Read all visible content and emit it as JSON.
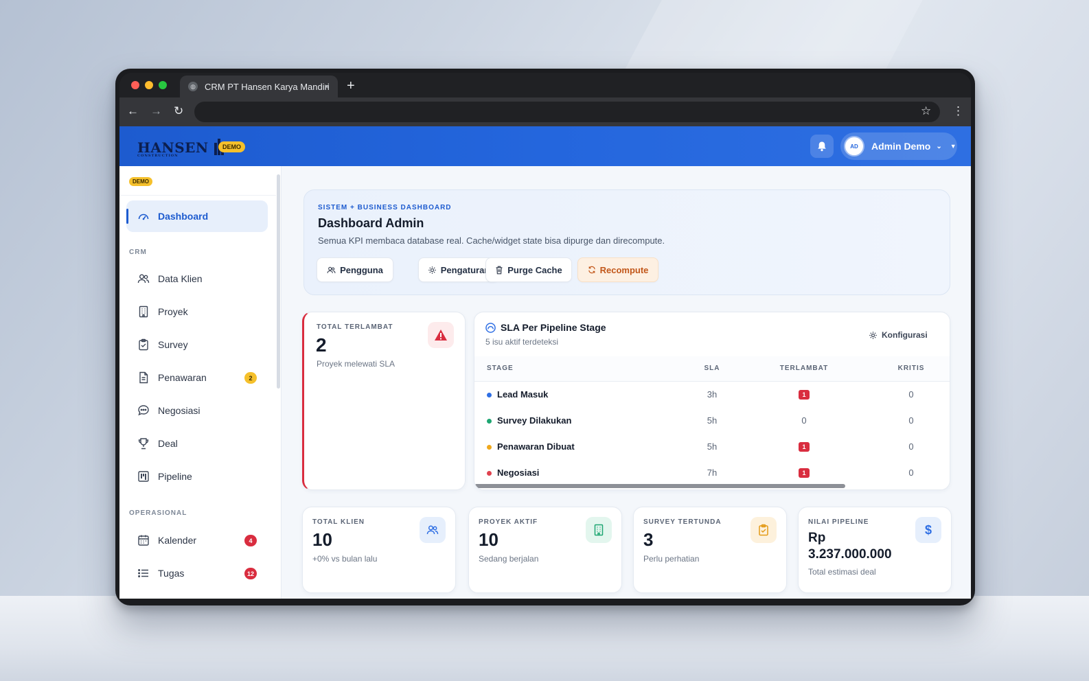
{
  "browser": {
    "tab_title": "CRM PT Hansen Karya Mandiri",
    "new_tab": "+",
    "tab_close": "×"
  },
  "app": {
    "logo_text": "HANSEN",
    "logo_sub": "CONSTRUCTION",
    "demo_badge": "DEMO",
    "user_initials": "AD",
    "user_name": "Admin Demo"
  },
  "sidebar": {
    "demo_badge": "DEMO",
    "dashboard": "Dashboard",
    "section_crm": "CRM",
    "items_crm": [
      {
        "label": "Data Klien",
        "icon": "users-icon"
      },
      {
        "label": "Proyek",
        "icon": "building-icon"
      },
      {
        "label": "Survey",
        "icon": "clipboard-icon"
      },
      {
        "label": "Penawaran",
        "icon": "document-icon",
        "badge": "2"
      },
      {
        "label": "Negosiasi",
        "icon": "chat-icon"
      },
      {
        "label": "Deal",
        "icon": "trophy-icon"
      },
      {
        "label": "Pipeline",
        "icon": "kanban-icon"
      }
    ],
    "section_ops": "OPERASIONAL",
    "items_ops": [
      {
        "label": "Kalender",
        "icon": "calendar-icon",
        "badge": "4"
      },
      {
        "label": "Tugas",
        "icon": "list-icon",
        "badge": "12"
      }
    ]
  },
  "hero": {
    "kicker": "SISTEM + BUSINESS DASHBOARD",
    "title": "Dashboard Admin",
    "subtitle": "Semua KPI membaca database real. Cache/widget state bisa dipurge dan direcompute.",
    "buttons": [
      "Pengguna",
      "Pengaturan",
      "Purge Cache",
      "Recompute"
    ]
  },
  "late": {
    "label": "TOTAL TERLAMBAT",
    "value": "2",
    "caption": "Proyek melewati SLA"
  },
  "sla": {
    "title": "SLA Per Pipeline Stage",
    "subtitle": "5 isu aktif terdeteksi",
    "config": "Konfigurasi",
    "columns": [
      "STAGE",
      "SLA",
      "TERLAMBAT",
      "KRITIS"
    ],
    "rows": [
      {
        "stage": "Lead Masuk",
        "sla": "3h",
        "late": "1",
        "critical": "0",
        "color": "#2f6fe4"
      },
      {
        "stage": "Survey Dilakukan",
        "sla": "5h",
        "late": "0",
        "critical": "0",
        "color": "#1ea672"
      },
      {
        "stage": "Penawaran Dibuat",
        "sla": "5h",
        "late": "1",
        "critical": "0",
        "color": "#f0a81c"
      },
      {
        "stage": "Negosiasi",
        "sla": "7h",
        "late": "1",
        "critical": "0",
        "color": "#e0424f"
      }
    ]
  },
  "kpis": [
    {
      "label": "TOTAL KLIEN",
      "value": "10",
      "caption": "+0% vs bulan lalu",
      "icon": "users-icon",
      "color": "#2f6fe4",
      "bg": "#e6effc"
    },
    {
      "label": "PROYEK AKTIF",
      "value": "10",
      "caption": "Sedang berjalan",
      "icon": "building-icon",
      "color": "#1ea672",
      "bg": "#e3f6ee"
    },
    {
      "label": "SURVEY TERTUNDA",
      "value": "3",
      "caption": "Perlu perhatian",
      "icon": "clipboard-icon",
      "color": "#e39a16",
      "bg": "#fdf1dc"
    },
    {
      "label": "NILAI PIPELINE",
      "value_line1": "Rp",
      "value_line2": "3.237.000.000",
      "caption": "Total estimasi deal",
      "icon": "dollar-icon",
      "color": "#2f6fe4",
      "bg": "#e6effc"
    }
  ]
}
